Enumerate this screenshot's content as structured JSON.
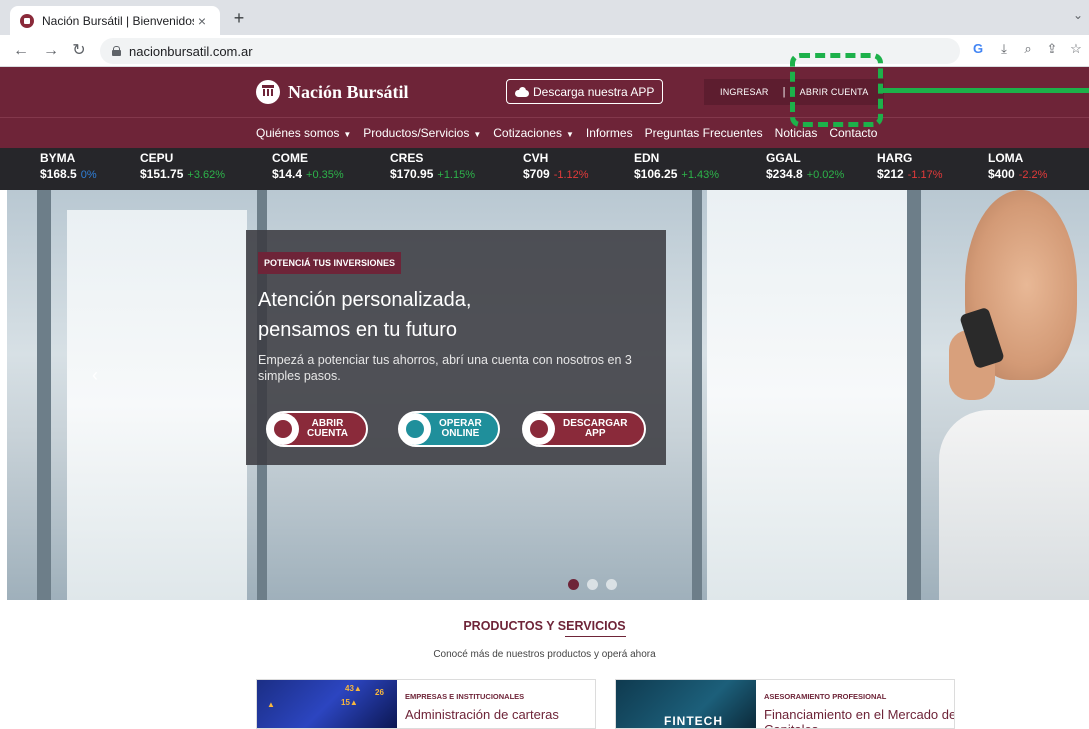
{
  "browser": {
    "tab_title": "Nación Bursátil | Bienvenidos",
    "tab_close": "×",
    "new_tab": "+",
    "url": "nacionbursatil.com.ar"
  },
  "header": {
    "brand": "Nación Bursátil",
    "app_button": "Descarga nuestra APP",
    "login": "INGRESAR",
    "separator": "|",
    "open_account": "ABRIR CUENTA"
  },
  "nav": {
    "items": [
      {
        "label": "Quiénes somos",
        "dropdown": true
      },
      {
        "label": "Productos/Servicios",
        "dropdown": true
      },
      {
        "label": "Cotizaciones",
        "dropdown": true
      },
      {
        "label": "Informes",
        "dropdown": false
      },
      {
        "label": "Preguntas Frecuentes",
        "dropdown": false
      },
      {
        "label": "Noticias",
        "dropdown": false
      },
      {
        "label": "Contacto",
        "dropdown": false
      }
    ]
  },
  "ticker": [
    {
      "symbol": "BYMA",
      "price": "$168.5",
      "change": "0%",
      "trend": "neutral"
    },
    {
      "symbol": "CEPU",
      "price": "$151.75",
      "change": "+3.62%",
      "trend": "up"
    },
    {
      "symbol": "COME",
      "price": "$14.4",
      "change": "+0.35%",
      "trend": "up"
    },
    {
      "symbol": "CRES",
      "price": "$170.95",
      "change": "+1.15%",
      "trend": "up"
    },
    {
      "symbol": "CVH",
      "price": "$709",
      "change": "-1.12%",
      "trend": "down"
    },
    {
      "symbol": "EDN",
      "price": "$106.25",
      "change": "+1.43%",
      "trend": "up"
    },
    {
      "symbol": "GGAL",
      "price": "$234.8",
      "change": "+0.02%",
      "trend": "up"
    },
    {
      "symbol": "HARG",
      "price": "$212",
      "change": "-1.17%",
      "trend": "down"
    },
    {
      "symbol": "LOMA",
      "price": "$400",
      "change": "-2.2%",
      "trend": "down"
    }
  ],
  "hero": {
    "eyebrow": "POTENCIÁ TUS INVERSIONES",
    "title_line1": "Atención personalizada,",
    "title_line2": "pensamos en tu futuro",
    "text": "Empezá a potenciar tus ahorros, abrí una cuenta con nosotros en 3 simples pasos.",
    "cta_abrir_1": "ABRIR",
    "cta_abrir_2": "CUENTA",
    "cta_operar_1": "OPERAR",
    "cta_operar_2": "ONLINE",
    "cta_descargar_1": "DESCARGAR",
    "cta_descargar_2": "APP",
    "prev": "‹",
    "active_slide": 1,
    "slide_count": 3
  },
  "products": {
    "title": "PRODUCTOS Y SERVICIOS",
    "subtitle": "Conocé más de nuestros productos y operá ahora",
    "cards": [
      {
        "category": "EMPRESAS E INSTITUCIONALES",
        "title": "Administración de carteras",
        "image_label": ""
      },
      {
        "category": "ASESORAMIENTO PROFESIONAL",
        "title": "Financiamiento en el Mercado de Capitales",
        "image_label": "FINTECH"
      }
    ]
  },
  "colors": {
    "brand": "#6e2438",
    "teal": "#1f8f9b",
    "up": "#2db34a",
    "down": "#e43a3a",
    "annotation": "#1db14a"
  }
}
